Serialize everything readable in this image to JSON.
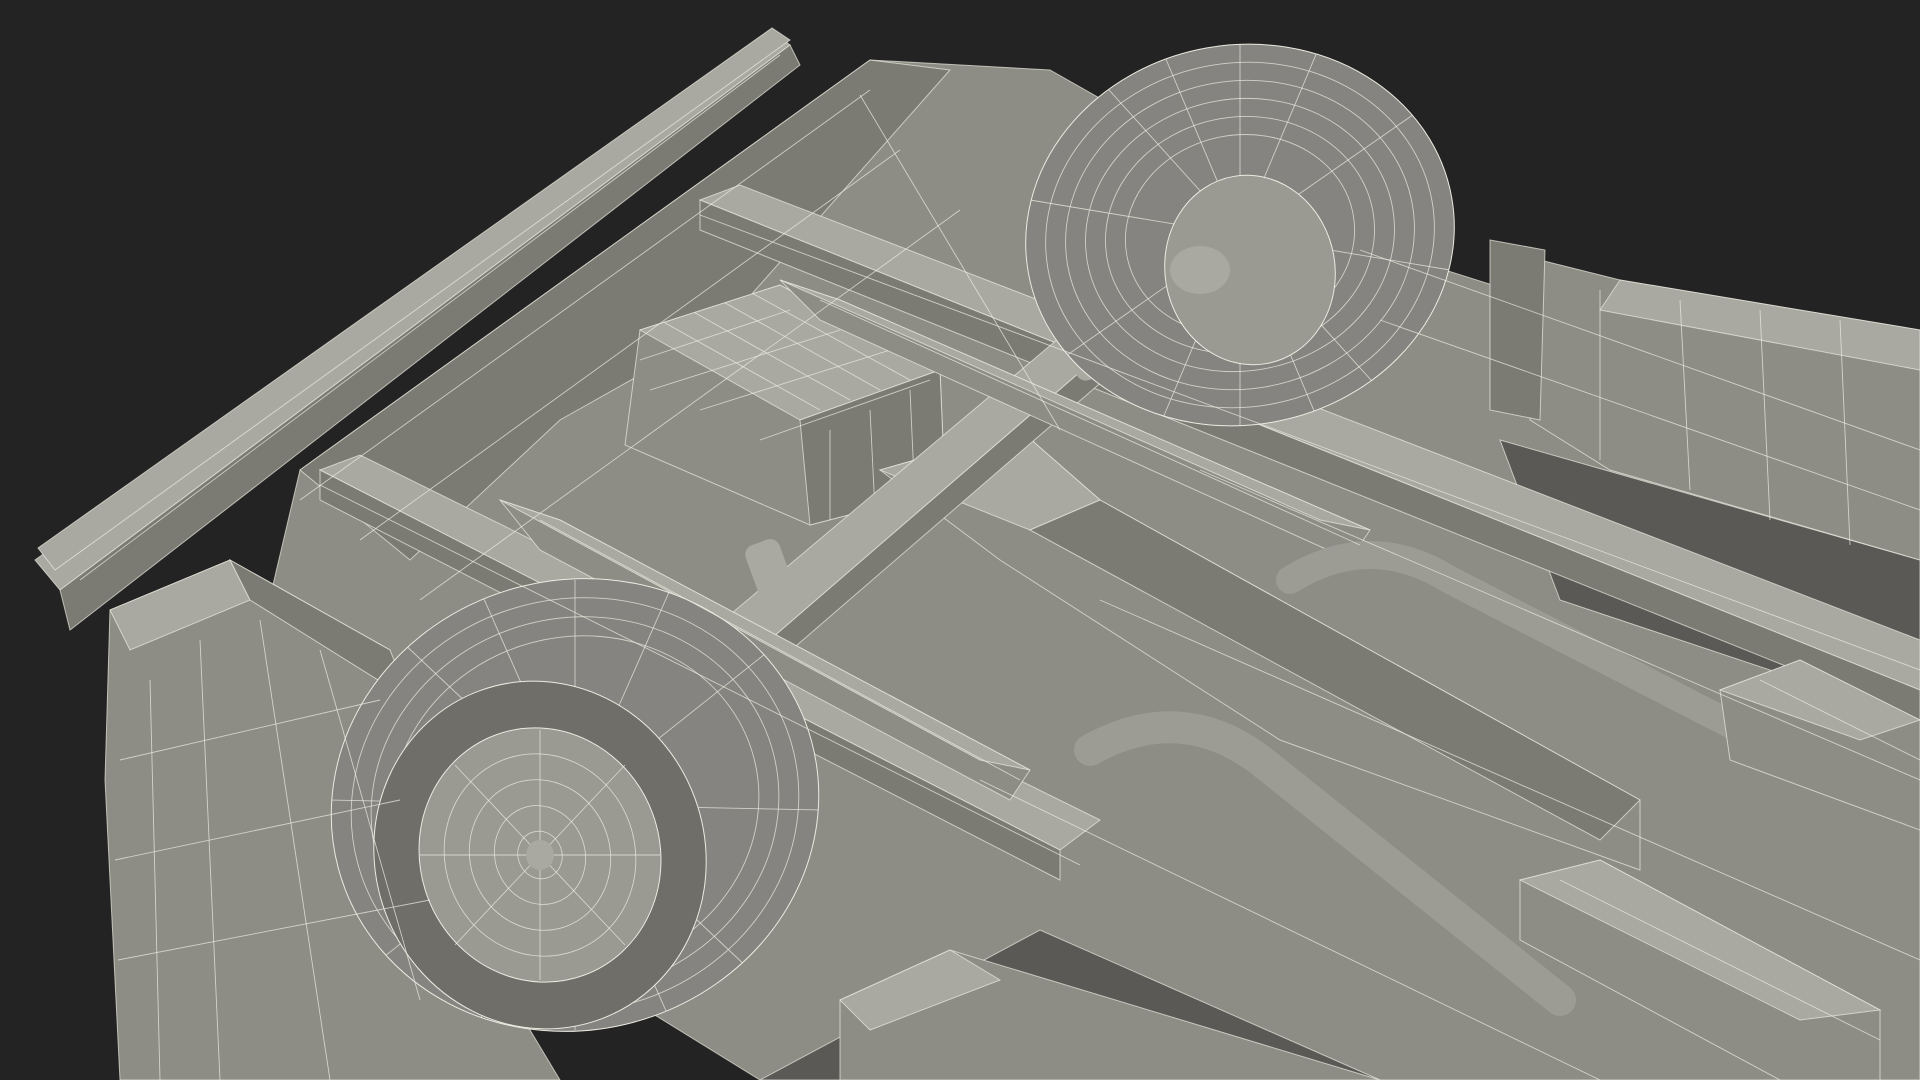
{
  "scene": {
    "subject": "wireframe-car-underside",
    "colors": {
      "background": "#232323",
      "surface": "#8d8c85",
      "surface_light": "#a9a8a1",
      "surface_mid": "#7b7a73",
      "surface_dark": "#5a5955",
      "shadow": "#3c3c39",
      "wire": "#ebebe0"
    }
  }
}
